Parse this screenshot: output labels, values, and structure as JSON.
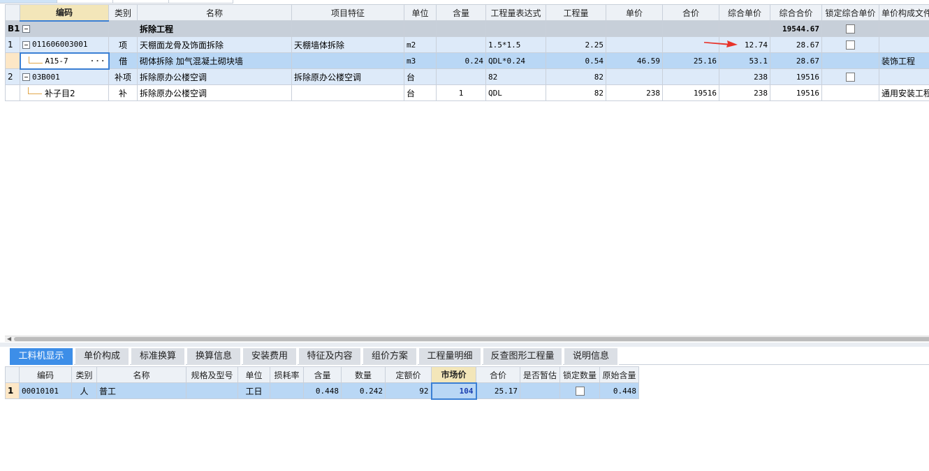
{
  "colors": {
    "header_bg": "#edf1f6",
    "active_header": "#f3e6b9",
    "section_row": "#c7cfd9",
    "item_row": "#ddeaf9",
    "selected_row": "#b9d7f5",
    "accent_blue": "#3d8ee8",
    "arrow_red": "#e8332a"
  },
  "upper_table": {
    "headers": [
      "编码",
      "类别",
      "名称",
      "项目特征",
      "单位",
      "含量",
      "工程量表达式",
      "工程量",
      "单价",
      "合价",
      "综合单价",
      "综合合价",
      "锁定综合单价",
      "单价构成文件"
    ],
    "section": {
      "index": "B1",
      "name": "拆除工程",
      "total": "19544.67"
    },
    "rows": [
      {
        "index": "1",
        "code": "011606003001",
        "type": "项",
        "name": "天棚面龙骨及饰面拆除",
        "feature": "天棚墙体拆除",
        "unit": "m2",
        "content": "",
        "expr": "1.5*1.5",
        "qty": "2.25",
        "price": "",
        "amount": "",
        "comp_price": "12.74",
        "comp_amount": "28.67",
        "locked": false,
        "file": ""
      },
      {
        "index": "",
        "code": "A15-7",
        "type": "借",
        "name": "砌体拆除 加气混凝土砌块墙",
        "feature": "",
        "unit": "m3",
        "content": "0.24",
        "expr": "QDL*0.24",
        "qty": "0.54",
        "price": "46.59",
        "amount": "25.16",
        "comp_price": "53.1",
        "comp_amount": "28.67",
        "locked": null,
        "file": "装饰工程"
      },
      {
        "index": "2",
        "code": "03B001",
        "type": "补项",
        "name": "拆除原办公楼空调",
        "feature": "拆除原办公楼空调",
        "unit": "台",
        "content": "",
        "expr": "82",
        "qty": "82",
        "price": "",
        "amount": "",
        "comp_price": "238",
        "comp_amount": "19516",
        "locked": false,
        "file": ""
      },
      {
        "index": "",
        "code": "补子目2",
        "type": "补",
        "name": "拆除原办公楼空调",
        "feature": "",
        "unit": "台",
        "content": "1",
        "expr": "QDL",
        "qty": "82",
        "price": "238",
        "amount": "19516",
        "comp_price": "238",
        "comp_amount": "19516",
        "locked": null,
        "file": "通用安装工程"
      }
    ]
  },
  "tabs": [
    "工料机显示",
    "单价构成",
    "标准换算",
    "换算信息",
    "安装费用",
    "特征及内容",
    "组价方案",
    "工程量明细",
    "反查图形工程量",
    "说明信息"
  ],
  "lower_table": {
    "headers": [
      "编码",
      "类别",
      "名称",
      "规格及型号",
      "单位",
      "损耗率",
      "含量",
      "数量",
      "定额价",
      "市场价",
      "合价",
      "是否暂估",
      "锁定数量",
      "原始含量"
    ],
    "rows": [
      {
        "index": "1",
        "code": "00010101",
        "type": "人",
        "name": "普工",
        "spec": "",
        "unit": "工日",
        "loss": "",
        "content": "0.448",
        "qty": "0.242",
        "quota_price": "92",
        "market_price": "104",
        "amount": "25.17",
        "estimate": "",
        "lock_qty": false,
        "orig_content": "0.448"
      }
    ]
  }
}
